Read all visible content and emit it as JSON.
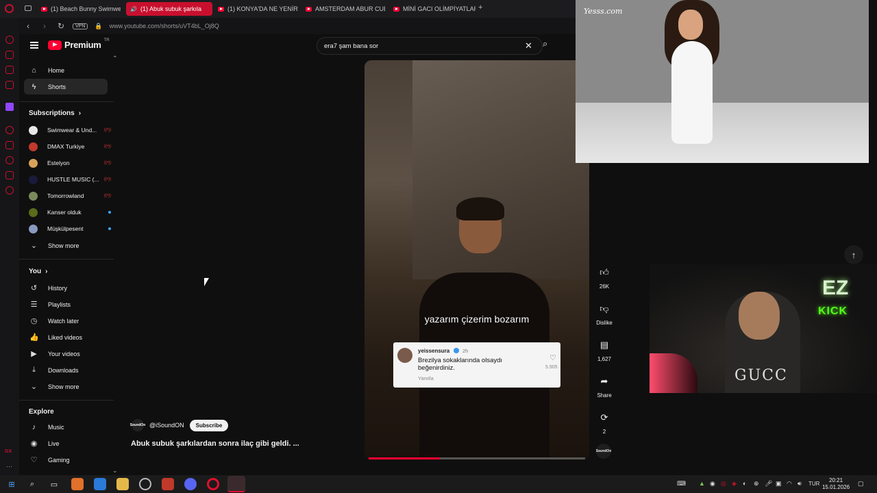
{
  "browser": {
    "tabs": [
      {
        "label": "(1) Beach Bunny Swimwear"
      },
      {
        "label": "(1) Abuk subuk şarkıla"
      },
      {
        "label": "(1) KONYA'DA NE YENİR N"
      },
      {
        "label": "AMSTERDAM ABUR CUBU"
      },
      {
        "label": "MİNİ GACI OLİMPİYATLAR"
      }
    ],
    "new_tab": "+",
    "vpn_label": "VPN",
    "url": "www.youtube.com/shorts/uVT4bL_Oj8Q"
  },
  "youtube": {
    "logo_text": "Premium",
    "logo_region": "TR",
    "search": {
      "value": "era7 şam bana sor"
    },
    "nav": [
      {
        "label": "Home",
        "icon": "home-icon"
      },
      {
        "label": "Shorts",
        "icon": "shorts-icon"
      }
    ],
    "subscriptions_heading": "Subscriptions",
    "subscriptions": [
      {
        "name": "Swimwear & Und...",
        "live": "((•))"
      },
      {
        "name": "DMAX Turkiye",
        "live": "((•))"
      },
      {
        "name": "Estelyon",
        "live": "((•))"
      },
      {
        "name": "HUSTLE MUSIC (...",
        "live": "((•))"
      },
      {
        "name": "Tomorrowland",
        "live": "((•))"
      },
      {
        "name": "Kanser olduk",
        "live": ""
      },
      {
        "name": "Müşkülpesent",
        "live": ""
      }
    ],
    "show_more": "Show more",
    "you_heading": "You",
    "you_items": [
      {
        "label": "History",
        "icon": "history-icon"
      },
      {
        "label": "Playlists",
        "icon": "playlists-icon"
      },
      {
        "label": "Watch later",
        "icon": "watch-later-icon"
      },
      {
        "label": "Liked videos",
        "icon": "liked-icon"
      },
      {
        "label": "Your videos",
        "icon": "your-videos-icon"
      },
      {
        "label": "Downloads",
        "icon": "downloads-icon"
      }
    ],
    "explore_heading": "Explore",
    "explore_items": [
      {
        "label": "Music",
        "icon": "music-icon"
      },
      {
        "label": "Live",
        "icon": "live-icon"
      },
      {
        "label": "Gaming",
        "icon": "gaming-icon"
      }
    ]
  },
  "short": {
    "channel": "@iSoundON",
    "channel_avatar_text": "SoundOn",
    "subscribe_label": "Subscribe",
    "title": "Abuk subuk şarkılardan sonra ilaç gibi geldi. ...",
    "caption": "yazarım çizerim bozarım",
    "progress_fraction": 0.33,
    "comment": {
      "user": "yeissensura",
      "time": "2h",
      "text": "Brezilya sokaklarında olsaydı beğenirdiniz.",
      "reply": "Yanıtla",
      "likes": "5.905"
    },
    "actions": [
      {
        "label": "26K",
        "icon": "like-icon"
      },
      {
        "label": "Dislike",
        "icon": "dislike-icon"
      },
      {
        "label": "1,627",
        "icon": "comment-icon"
      },
      {
        "label": "Share",
        "icon": "share-icon"
      },
      {
        "label": "2",
        "icon": "remix-icon"
      }
    ]
  },
  "overlays": {
    "pip_watermark": "Yesss.com",
    "cam_brand": "GUCC",
    "cam_logo_top": "EZ",
    "cam_logo_bottom": "KICK"
  },
  "taskbar": {
    "language": "TUR",
    "time": "20:21",
    "date": "15.01.2026"
  },
  "colors": {
    "accent": "#ff0033",
    "active_tab": "#c8102e",
    "background": "#0f0f0f",
    "kick_green": "#53fc18"
  }
}
